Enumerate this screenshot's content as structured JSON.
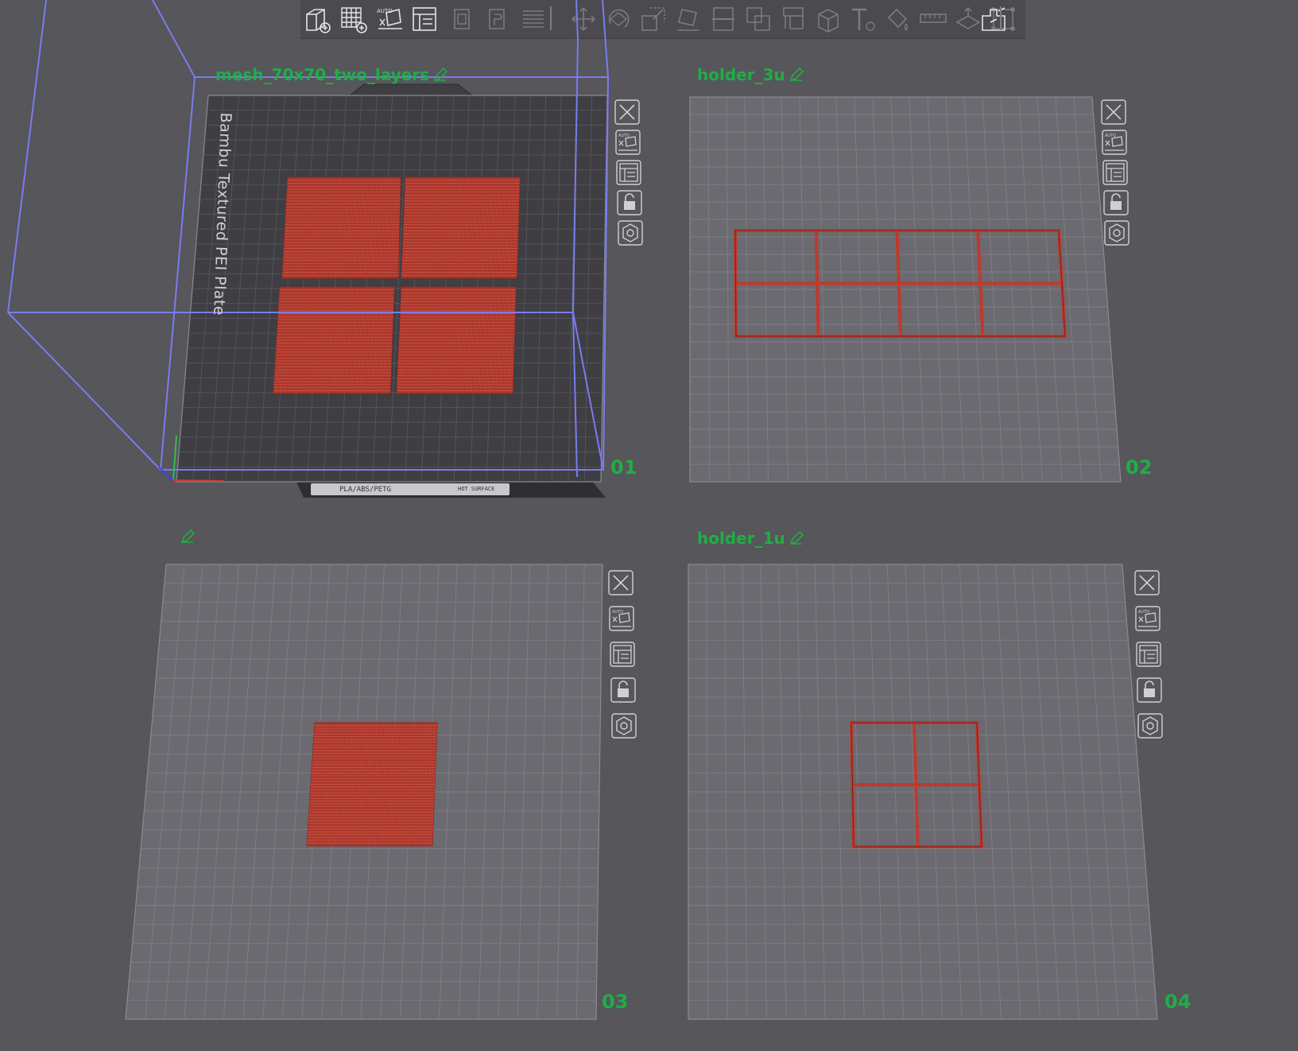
{
  "toolbar": {
    "items": [
      {
        "name": "add-object-icon",
        "enabled": true
      },
      {
        "name": "add-plate-icon",
        "enabled": true
      },
      {
        "name": "auto-orient-icon",
        "enabled": true,
        "label": "AUTO"
      },
      {
        "name": "arrange-icon",
        "enabled": true
      },
      {
        "name": "copy-icon",
        "enabled": false
      },
      {
        "name": "paste-icon",
        "enabled": false
      },
      {
        "name": "layers-icon",
        "enabled": false
      },
      {
        "name": "move-icon",
        "enabled": false
      },
      {
        "name": "rotate-icon",
        "enabled": false
      },
      {
        "name": "scale-icon",
        "enabled": false
      },
      {
        "name": "lay-on-face-icon",
        "enabled": false
      },
      {
        "name": "cut-icon",
        "enabled": false
      },
      {
        "name": "boolean-icon",
        "enabled": false
      },
      {
        "name": "support-paint-icon",
        "enabled": false
      },
      {
        "name": "seam-paint-icon",
        "enabled": false
      },
      {
        "name": "text-icon",
        "enabled": false
      },
      {
        "name": "color-paint-icon",
        "enabled": false
      },
      {
        "name": "measure-icon",
        "enabled": false
      },
      {
        "name": "assembly-icon",
        "enabled": false
      },
      {
        "name": "variable-height-icon",
        "enabled": false
      },
      {
        "name": "split-icon",
        "enabled": true
      }
    ]
  },
  "plates": [
    {
      "number": "01",
      "title": "mesh_70x70_two_layers",
      "bed_text": "Bambu Textured PEI Plate",
      "bed_label": "PLA/ABS/PETG",
      "bed_hot": "HOT SURFACE"
    },
    {
      "number": "02",
      "title": "holder_3u"
    },
    {
      "number": "03",
      "title": ""
    },
    {
      "number": "04",
      "title": "holder_1u"
    }
  ],
  "plate_tools": [
    "close-icon",
    "auto-arrange-icon",
    "arrange-plate-icon",
    "lock-icon",
    "plate-settings-icon"
  ],
  "colors": {
    "background": "#56565b",
    "accent_green": "#1fae45",
    "model_red": "#c0392b",
    "selection_blue": "#7b7bf0",
    "plate_gray": "#6a6a70"
  }
}
